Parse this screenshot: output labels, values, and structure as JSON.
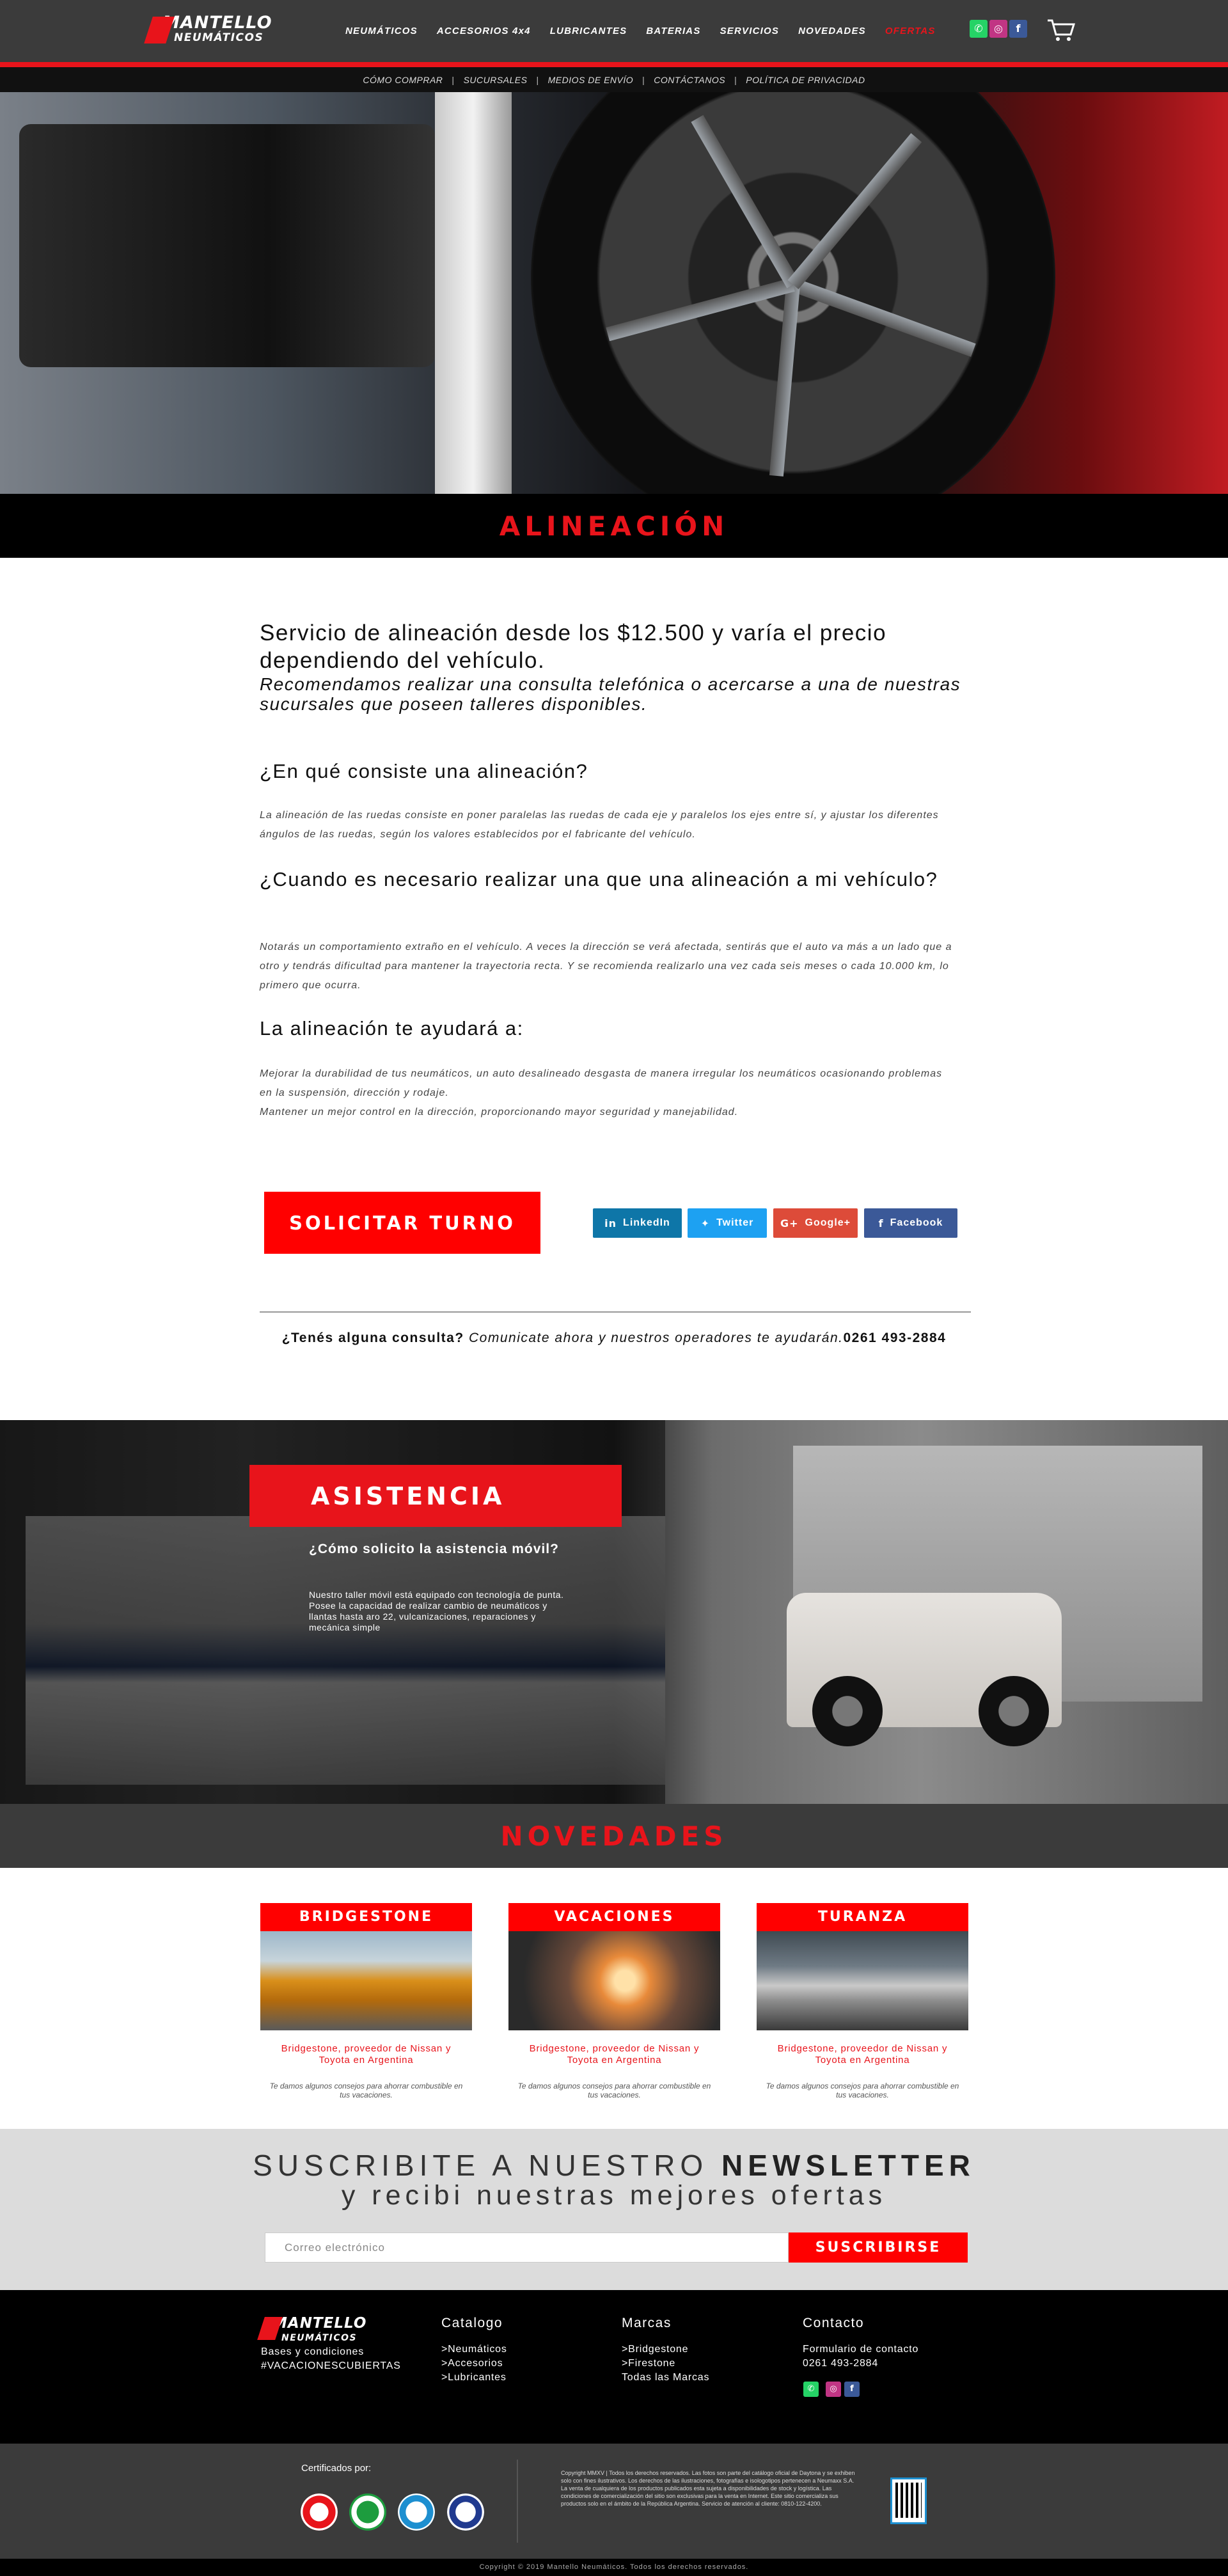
{
  "header": {
    "logo_top": "MANTELLO",
    "logo_bottom": "NEUMÁTICOS",
    "nav": [
      "NEUMÁTICOS",
      "ACCESORIOS 4x4",
      "LUBRICANTES",
      "BATERIAS",
      "SERVICIOS",
      "NOVEDADES",
      "OFERTAS"
    ],
    "subnav": [
      "CÓMO COMPRAR",
      "SUCURSALES",
      "MEDIOS DE ENVÍO",
      "CONTÁCTANOS",
      "POLÍTICA DE PRIVACIDAD"
    ],
    "social": [
      "whatsapp-icon",
      "instagram-icon",
      "facebook-icon"
    ],
    "cart_icon": "cart-icon"
  },
  "hero": {
    "title": "ALINEACIÓN"
  },
  "content": {
    "lead": "Servicio de alineación desde los $12.500 y varía el precio dependiendo del vehículo.",
    "lead_italic": "Recomendamos realizar una consulta telefónica o acercarse a una de nuestras sucursales que poseen talleres disponibles.",
    "q1": "¿En qué consiste una alineación?",
    "p1": "La alineación de las ruedas consiste en poner paralelas las ruedas de cada eje y paralelos los ejes entre sí, y ajustar los diferentes ángulos de las ruedas, según los valores establecidos por el fabricante del vehículo.",
    "q2": "¿Cuando es necesario realizar una que una alineación a mi vehículo?",
    "p2": "Notarás un comportamiento extraño en el vehículo. A veces la dirección se verá afectada, sentirás que el auto va más a un lado que a otro y tendrás dificultad para mantener la trayectoria recta. Y se recomienda realizarlo una vez cada seis meses o cada 10.000 km, lo primero que ocurra.",
    "q3": "La alineación te ayudará a:",
    "p3a": "Mejorar la durabilidad de tus neumáticos, un auto desalineado desgasta de manera irregular los neumáticos ocasionando problemas en la suspensión, dirección y rodaje.",
    "p3b": "Mantener un mejor control en la dirección, proporcionando mayor seguridad y manejabilidad.",
    "cta": "SOLICITAR TURNO",
    "share": [
      {
        "label": "LinkedIn",
        "icon": "in",
        "color": "#0e76a8"
      },
      {
        "label": "Twitter",
        "icon": "🐦",
        "color": "#1da1f2"
      },
      {
        "label": "Google+",
        "icon": "G+",
        "color": "#dd4b39"
      },
      {
        "label": "Facebook",
        "icon": "f",
        "color": "#3b5998"
      }
    ],
    "consulta_bold": "¿Tenés alguna consulta?",
    "consulta_italic": "Comunicate ahora y nuestros operadores te ayudarán.",
    "consulta_phone": "0261 493-2884"
  },
  "asistencia": {
    "title": "ASISTENCIA",
    "question": "¿Cómo solicito la asistencia móvil?",
    "text": "Nuestro taller móvil está equipado con tecnología de punta. Posee la capacidad de realizar cambio de neumáticos y llantas hasta aro 22, vulcanizaciones, reparaciones y mecánica simple"
  },
  "novedades": {
    "title": "NOVEDADES",
    "cards": [
      {
        "head": "BRIDGESTONE",
        "title": "Bridgestone, proveedor de Nissan y Toyota en Argentina",
        "text": "Te damos algunos consejos para ahorrar combustible en tus vacaciones."
      },
      {
        "head": "VACACIONES",
        "title": "Bridgestone, proveedor de Nissan y Toyota en Argentina",
        "text": "Te damos algunos consejos para ahorrar combustible en tus vacaciones."
      },
      {
        "head": "TURANZA",
        "title": "Bridgestone, proveedor de Nissan y Toyota en Argentina",
        "text": "Te damos algunos consejos para ahorrar combustible en tus vacaciones."
      }
    ]
  },
  "newsletter": {
    "line1_a": "SUSCRIBITE A NUESTRO",
    "line1_b": "NEWSLETTER",
    "line2": "y recibi nuestras mejores ofertas",
    "placeholder": "Correo electrónico",
    "button": "SUSCRIBIRSE"
  },
  "footer": {
    "logo_top": "MANTELLO",
    "logo_bottom": "NEUMÁTICOS",
    "left_links": [
      "Bases y condiciones",
      "#VACACIONESCUBIERTAS"
    ],
    "catalogo_title": "Catalogo",
    "catalogo": [
      ">Neumáticos",
      ">Accesorios",
      ">Lubricantes"
    ],
    "marcas_title": "Marcas",
    "marcas": [
      ">Bridgestone",
      ">Firestone",
      "Todas las Marcas"
    ],
    "contacto_title": "Contacto",
    "contacto": [
      "Formulario de contacto",
      "0261 493-2884"
    ],
    "certificados": "Certificados por:",
    "legal": "Copyright MMXV | Todos los derechos reservados. Las fotos son parte del catálogo oficial de Daytona y se exhiben solo con fines ilustrativos. Los derechos de las ilustraciones, fotografías e isologotipos pertenecen a Neumaxx S.A. La venta de cualquiera de los productos publicados esta sujeta a disponibilidades de stock y logística. Las condiciones de comercialización del sitio son exclusivas para la venta en Internet. Este sitio comercializa sus productos solo en el ámbito de la República Argentina. Servicio de atención al cliente: 0810-122-4200.",
    "copyright": "Copyright © 2019 Mantello Neumáticos. Todos los derechos reservados."
  }
}
